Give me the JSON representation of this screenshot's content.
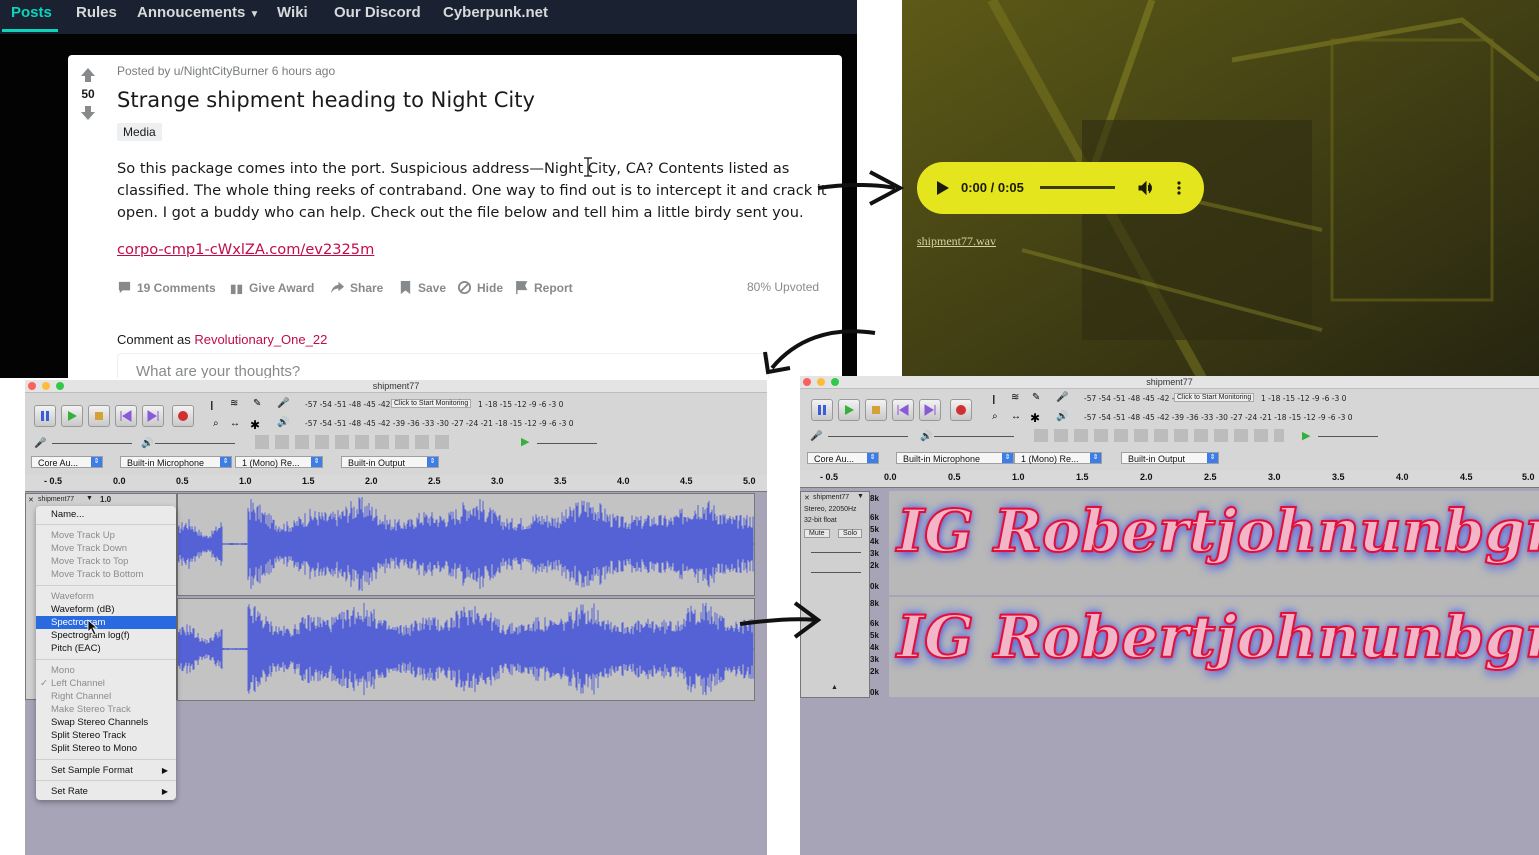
{
  "reddit": {
    "nav": [
      "Posts",
      "Rules",
      "Annoucements",
      "Wiki",
      "Our Discord",
      "Cyberpunk.net"
    ],
    "vote_count": "50",
    "meta": "Posted by u/NightCityBurner 6 hours ago",
    "title": "Strange shipment heading to Night City",
    "flair": "Media",
    "body": "So this package comes into the port. Suspicious address—Night City, CA? Contents listed as classified. The whole thing reeks of contraband. One way to find out is to intercept it and crack it open. I got a buddy who can help. Check out the file below and tell him a little birdy sent you.",
    "link": "corpo-cmp1-cWxlZA.com/ev2325m",
    "actions": {
      "comments": "19 Comments",
      "award": "Give Award",
      "share": "Share",
      "save": "Save",
      "hide": "Hide",
      "report": "Report"
    },
    "upvoted": "80% Upvoted",
    "comment_as_label": "Comment as",
    "comment_user": "Revolutionary_One_22",
    "comment_placeholder": "What are your thoughts?"
  },
  "player": {
    "time": "0:00 / 0:05",
    "progress_fraction": 0.6,
    "file_link": "shipment77.wav",
    "color": "#e4e51c"
  },
  "audacity": {
    "window_title": "shipment77",
    "meter_scale": "-57 -54 -51 -48 -45 -42 -",
    "meter_scale_2": "-57 -54 -51 -48 -45 -42 -39 -36 -33 -30 -27 -24 -21 -18 -15 -12 -9 -6 -3 0",
    "meter_scale_1b": "1 -18 -15 -12 -9 -6 -3 0",
    "monitor_label": "Click to Start Monitoring",
    "host": "Core Au...",
    "input_device": "Built-in Microphone",
    "channels": "1 (Mono) Re...",
    "output_device": "Built-in Output",
    "ruler_left": [
      "- 0.5",
      "0.0",
      "0.5",
      "1.0",
      "1.5",
      "2.0",
      "2.5",
      "3.0",
      "3.5",
      "4.0",
      "4.5",
      "5.0"
    ],
    "ruler_left_extra": "1.0",
    "track_name": "shipment77",
    "track_info": [
      "Stereo, 22050Hz",
      "32-bit float"
    ],
    "mute_label": "Mute",
    "solo_label": "Solo",
    "freq_labels": [
      "8k",
      "6k",
      "5k",
      "4k",
      "3k",
      "2k",
      "0k"
    ],
    "spectrogram_text": "IG Robertjohnunbgrond",
    "context_menu": {
      "name": "Name...",
      "move_up": "Move Track Up",
      "move_down": "Move Track Down",
      "move_top": "Move Track to Top",
      "move_bottom": "Move Track to Bottom",
      "waveform": "Waveform",
      "waveform_db": "Waveform (dB)",
      "spectrogram": "Spectrogram",
      "spectrogram_log": "Spectrogram log(f)",
      "pitch": "Pitch (EAC)",
      "mono": "Mono",
      "left": "Left Channel",
      "right": "Right Channel",
      "make_stereo": "Make Stereo Track",
      "swap": "Swap Stereo Channels",
      "split": "Split Stereo Track",
      "split_mono": "Split Stereo to Mono",
      "sample_format": "Set Sample Format",
      "set_rate": "Set Rate",
      "check": "✓"
    }
  },
  "colors": {
    "reddit_accent": "#0dd3bb",
    "link": "#c10d47",
    "wave": "#5462d6",
    "selection": "#2a6ae0"
  }
}
